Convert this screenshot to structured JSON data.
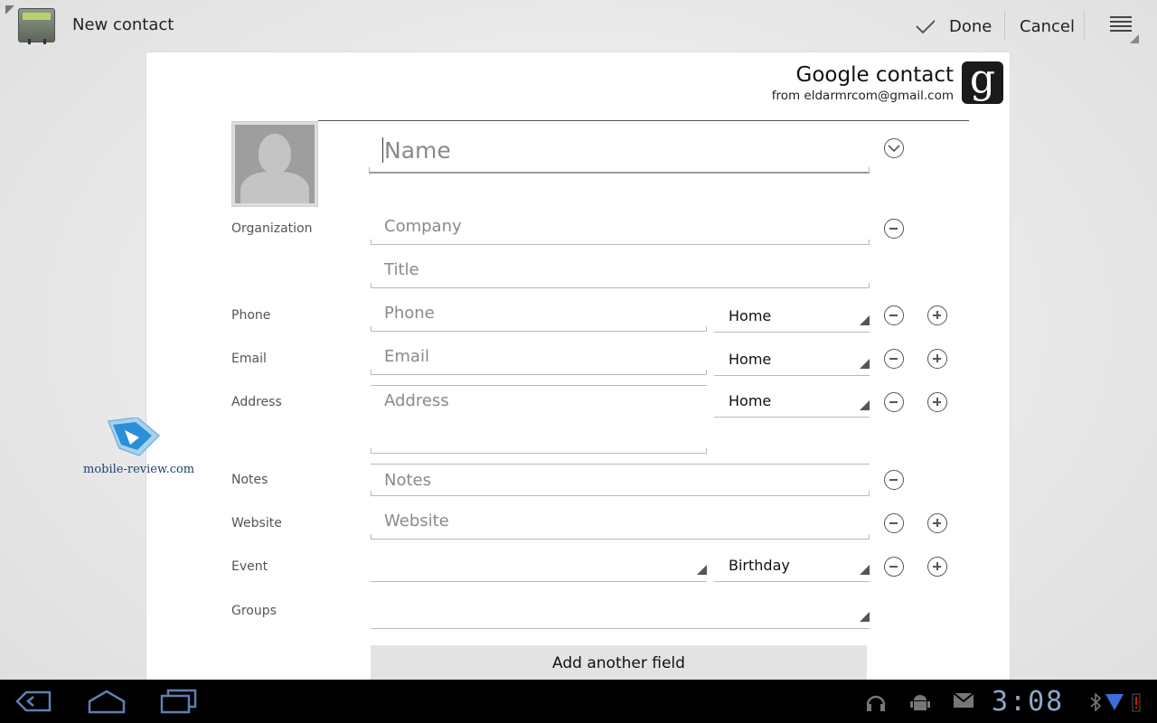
{
  "actionbar": {
    "title": "New contact",
    "done_label": "Done",
    "cancel_label": "Cancel"
  },
  "account": {
    "name": "Google contact",
    "from": "from eldarmrcom@gmail.com",
    "logo_letter": "g"
  },
  "form": {
    "name_placeholder": "Name",
    "labels": {
      "organization": "Organization",
      "phone": "Phone",
      "email": "Email",
      "address": "Address",
      "notes": "Notes",
      "website": "Website",
      "event": "Event",
      "groups": "Groups"
    },
    "placeholders": {
      "company": "Company",
      "title": "Title",
      "phone": "Phone",
      "email": "Email",
      "address": "Address",
      "notes": "Notes",
      "website": "Website"
    },
    "types": {
      "phone": "Home",
      "email": "Home",
      "address": "Home",
      "event": "Birthday"
    },
    "add_field_label": "Add another field"
  },
  "watermark": {
    "text": "mobile-review.com"
  },
  "statusbar": {
    "clock": "3:08"
  },
  "colors": {
    "accent_clock": "#8fa6c8",
    "battery_alert": "#e01010",
    "signal": "#3a6fd8"
  }
}
